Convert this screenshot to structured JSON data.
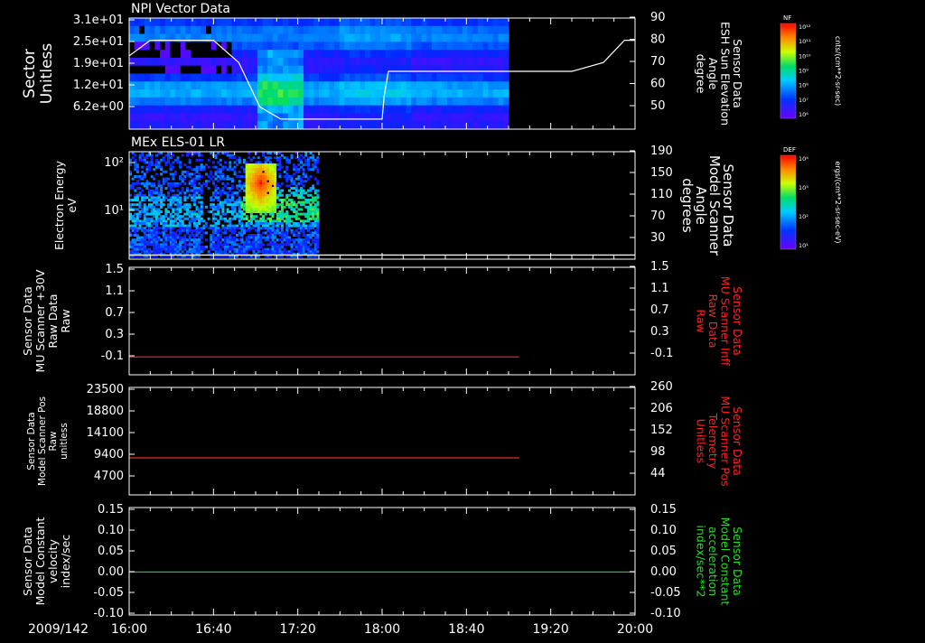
{
  "chart_data": {
    "type": "stacked-timeseries",
    "date_label": "2009/142",
    "time_ticks": [
      "16:00",
      "16:40",
      "17:20",
      "18:00",
      "18:40",
      "19:20",
      "20:00"
    ],
    "xlim": [
      "16:00",
      "20:00"
    ],
    "panels": [
      {
        "id": "npi",
        "type": "heatmap",
        "title": "NPI Vector Data",
        "ylabel": [
          "Sector",
          "Unitless"
        ],
        "yticks": [
          "3.1e+01",
          "2.5e+01",
          "1.9e+01",
          "1.2e+01",
          "6.2e+00"
        ],
        "right_label": [
          "Sensor Data",
          "ESH Sun Elevation",
          "Angle",
          "degree"
        ],
        "right_ticks": [
          "90",
          "80",
          "70",
          "60",
          "50"
        ],
        "right_lim": [
          40,
          90
        ],
        "data_end": "19:00",
        "overlay_line": {
          "color": "#ffffff",
          "points": [
            [
              "16:00",
              73
            ],
            [
              "16:10",
              80
            ],
            [
              "16:40",
              80
            ],
            [
              "16:52",
              70
            ],
            [
              "17:02",
              50
            ],
            [
              "17:12",
              44.5
            ],
            [
              "18:00",
              44.5
            ],
            [
              "18:01",
              55
            ],
            [
              "18:03",
              66
            ],
            [
              "19:30",
              66
            ],
            [
              "19:45",
              70
            ],
            [
              "19:55",
              80
            ],
            [
              "20:00",
              80
            ]
          ]
        },
        "colorbar": {
          "label": "NF",
          "unit": "cnts/(cm**2-sr-sec)",
          "ticks": [
            "10¹²",
            "10¹¹",
            "10¹⁰",
            "10⁹",
            "10⁸",
            "10⁷",
            "10⁶"
          ]
        }
      },
      {
        "id": "els",
        "type": "heatmap",
        "title": "MEx ELS-01 LR",
        "ylabel": [
          "Electron Energy",
          "eV"
        ],
        "yticks": [
          "10²",
          "10¹"
        ],
        "right_label": [
          "Sensor Data",
          "Model Scanner",
          "Angle",
          "degrees"
        ],
        "right_ticks": [
          "190",
          "150",
          "110",
          "70",
          "30"
        ],
        "right_lim": [
          10,
          190
        ],
        "data_end": "17:30",
        "overlay_line": {
          "color": "#ffffff",
          "points": [
            [
              "16:00",
              17
            ],
            [
              "20:00",
              17
            ]
          ]
        },
        "colorbar": {
          "label": "DEF",
          "unit": "ergs/(cm**2-sr-sec-eV)",
          "ticks": [
            "10⁴",
            "10³",
            "10²",
            "10¹"
          ]
        }
      },
      {
        "id": "mu30",
        "type": "line",
        "ylabel": [
          "Sensor Data",
          "MU Scanner +30V",
          "Raw Data",
          "Raw"
        ],
        "yticks": [
          "1.5",
          "1.1",
          "0.7",
          "0.3",
          "-0.1"
        ],
        "ylim": [
          -0.3,
          1.5
        ],
        "right_label": [
          "Sensor Data",
          "MU Scanner Inff",
          "Raw Data",
          "Raw"
        ],
        "right_label_color": "#ff2020",
        "right_ticks": [
          "1.5",
          "1.1",
          "0.7",
          "0.3",
          "-0.1"
        ],
        "series": [
          {
            "color": "#e03030",
            "points": [
              [
                "16:00",
                0.0
              ],
              [
                "19:05",
                0.0
              ]
            ]
          }
        ]
      },
      {
        "id": "pos",
        "type": "line",
        "ylabel": [
          "Sensor Data",
          "Model Scanner Pos",
          "Raw",
          "unitless"
        ],
        "yticks": [
          "23500",
          "18800",
          "14100",
          "9400",
          "4700"
        ],
        "ylim": [
          0,
          23500
        ],
        "right_label": [
          "Sensor Data",
          "MU Scanner Pos",
          "Telemetry",
          "Unitless"
        ],
        "right_label_color": "#ff2020",
        "right_ticks": [
          "260",
          "206",
          "152",
          "98",
          "44"
        ],
        "series": [
          {
            "color": "#e03030",
            "points": [
              [
                "16:00",
                8100
              ],
              [
                "19:05",
                8100
              ]
            ]
          }
        ]
      },
      {
        "id": "vel",
        "type": "line",
        "ylabel": [
          "Sensor Data",
          "Model Constant",
          "velocity",
          "index/sec"
        ],
        "yticks": [
          "0.15",
          "0.10",
          "0.05",
          "0.00",
          "-0.05",
          "-0.10"
        ],
        "ylim": [
          -0.1,
          0.15
        ],
        "right_label": [
          "Sensor Data",
          "Model Constant",
          "acceleration",
          "index/sec**2"
        ],
        "right_label_color": "#20e020",
        "right_ticks": [
          "0.15",
          "0.10",
          "0.05",
          "0.00",
          "-0.05",
          "-0.10"
        ],
        "series": [
          {
            "color": "#20c020",
            "points": [
              [
                "16:00",
                0.0
              ],
              [
                "20:00",
                0.0
              ]
            ]
          }
        ]
      }
    ]
  }
}
